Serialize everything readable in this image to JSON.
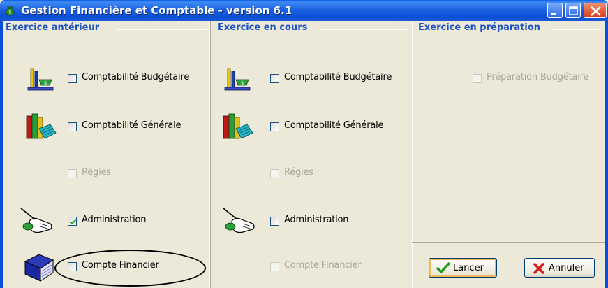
{
  "window": {
    "title": "Gestion Financière et Comptable - version 6.1"
  },
  "frames": {
    "anterieur": {
      "title": "Exercice antérieur",
      "items": [
        {
          "label": "Comptabilité Budgétaire",
          "checked": false,
          "enabled": true,
          "icon": "balance-scale-icon"
        },
        {
          "label": "Comptabilité Générale",
          "checked": false,
          "enabled": true,
          "icon": "books-icon"
        },
        {
          "label": "Régies",
          "checked": false,
          "enabled": false,
          "icon": ""
        },
        {
          "label": "Administration",
          "checked": true,
          "enabled": true,
          "icon": "hand-pointer-icon"
        },
        {
          "label": "Compte Financier",
          "checked": false,
          "enabled": true,
          "icon": "blue-book-icon"
        }
      ]
    },
    "en_cours": {
      "title": "Exercice en cours",
      "items": [
        {
          "label": "Comptabilité Budgétaire",
          "checked": false,
          "enabled": true,
          "icon": "balance-scale-icon"
        },
        {
          "label": "Comptabilité Générale",
          "checked": false,
          "enabled": true,
          "icon": "books-icon"
        },
        {
          "label": "Régies",
          "checked": false,
          "enabled": false,
          "icon": ""
        },
        {
          "label": "Administration",
          "checked": false,
          "enabled": true,
          "icon": "hand-pointer-icon"
        },
        {
          "label": "Compte Financier",
          "checked": false,
          "enabled": false,
          "icon": ""
        }
      ]
    },
    "preparation": {
      "title": "Exercice en préparation",
      "items": [
        {
          "label": "Préparation Budgétaire",
          "checked": false,
          "enabled": false
        }
      ]
    }
  },
  "buttons": {
    "lancer": "Lancer",
    "annuler": "Annuler"
  },
  "colors": {
    "titlebar": "#0b4fd6",
    "frame_title": "#1f52c2",
    "dialog_bg": "#ece9d8",
    "disabled_text": "#aca899",
    "annotation_ellipse": "#000000"
  }
}
